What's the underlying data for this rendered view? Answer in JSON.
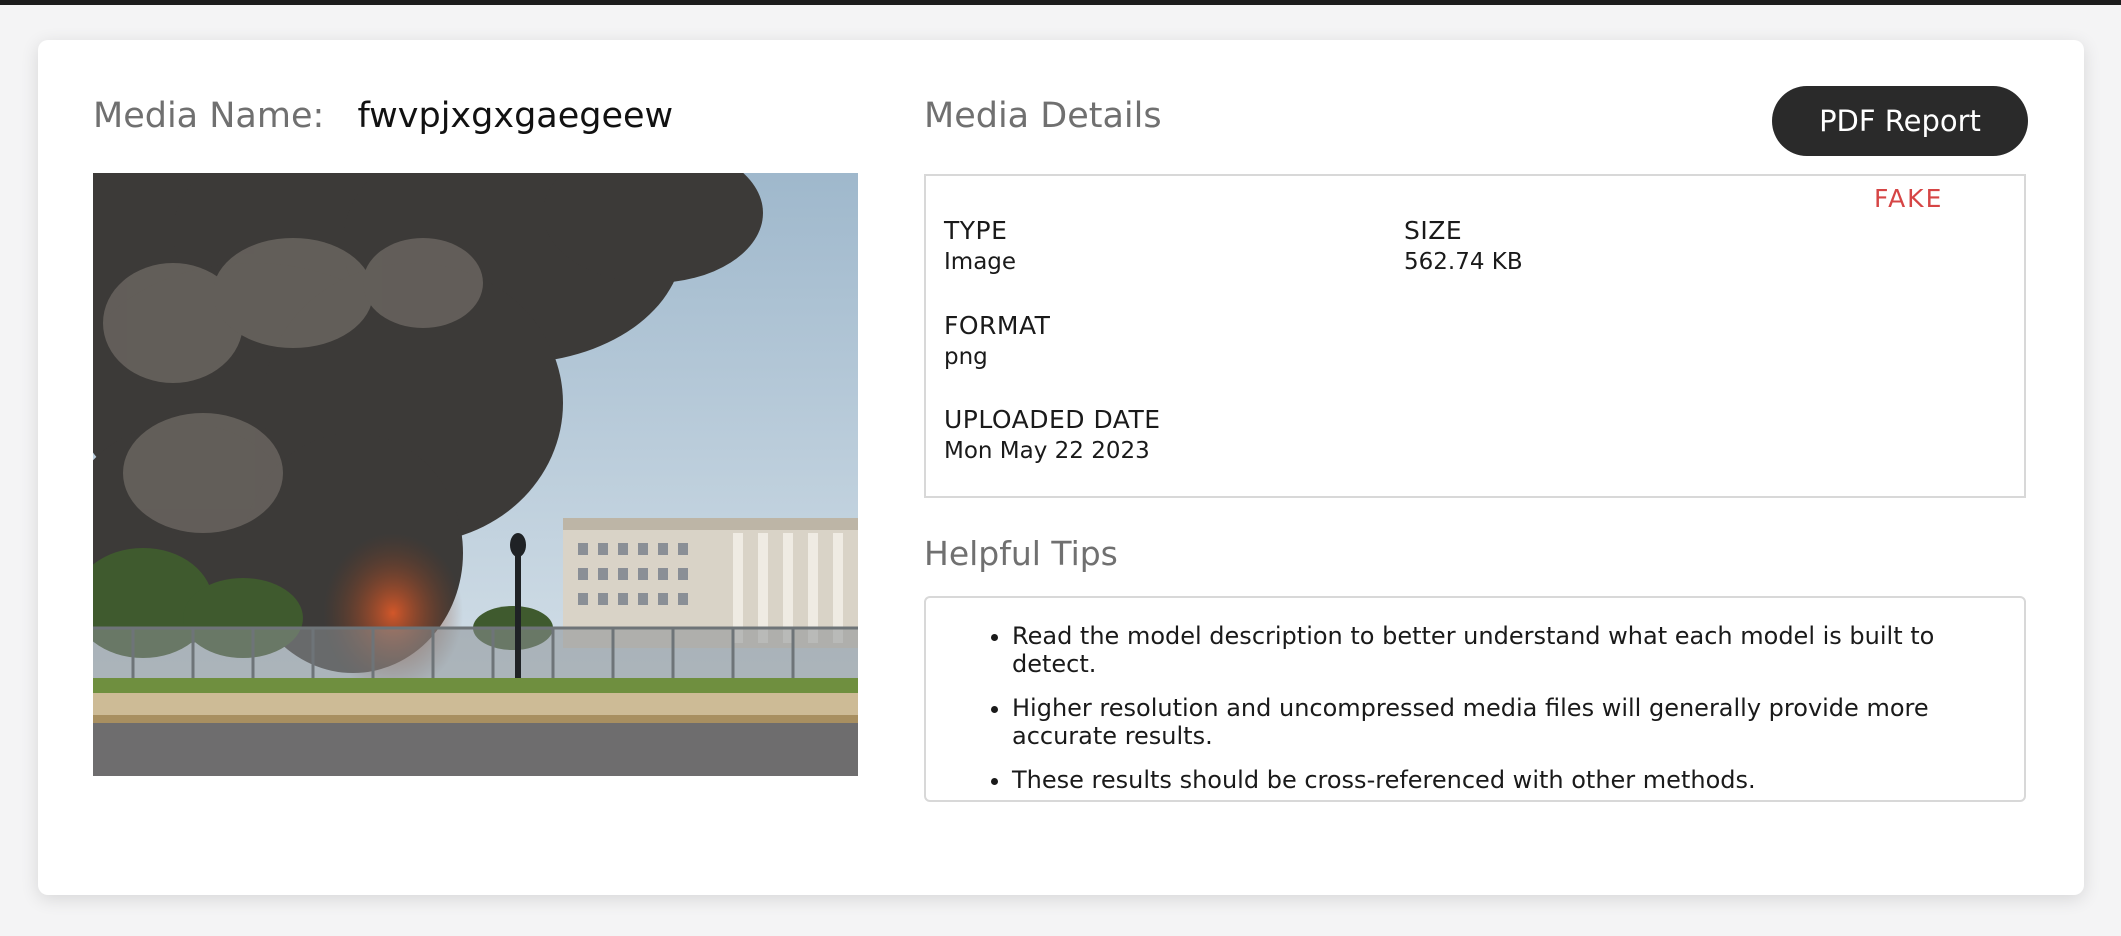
{
  "media": {
    "name_label": "Media Name:",
    "name_value": "fwvpjxgxgaegeew"
  },
  "details": {
    "title": "Media Details",
    "pdf_button_label": "PDF Report",
    "verdict": "FAKE",
    "type_label": "TYPE",
    "type_value": "Image",
    "size_label": "SIZE",
    "size_value": "562.74 KB",
    "format_label": "FORMAT",
    "format_value": "png",
    "uploaded_label": "UPLOADED DATE",
    "uploaded_value": "Mon May 22 2023"
  },
  "tips": {
    "title": "Helpful Tips",
    "items": [
      "Read the model description to better understand what each model is built to detect.",
      "Higher resolution and uncompressed media files will generally provide more accurate results.",
      "These results should be cross-referenced with other methods."
    ]
  },
  "colors": {
    "verdict": "#d64545",
    "button_bg": "#2a2a2a",
    "label_gray": "#707070"
  }
}
